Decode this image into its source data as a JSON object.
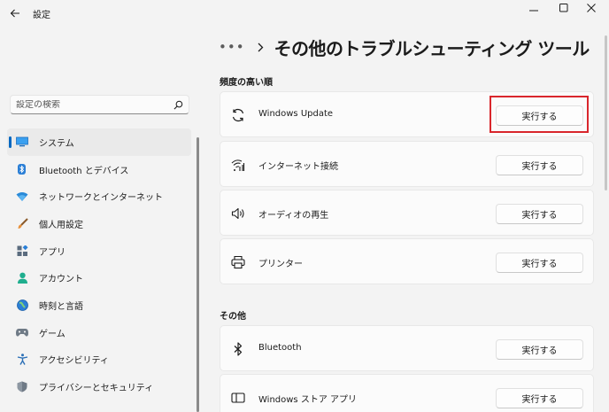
{
  "window": {
    "app_title": "設定",
    "back_icon": "back-arrow-icon",
    "minimize_icon": "minimize-icon",
    "maximize_icon": "maximize-icon",
    "close_icon": "close-icon"
  },
  "search": {
    "placeholder": "設定の検索",
    "icon": "search-icon"
  },
  "sidebar": {
    "items": [
      {
        "label": "システム",
        "icon": "system-display-icon",
        "selected": true
      },
      {
        "label": "Bluetooth とデバイス",
        "icon": "bluetooth-devices-icon",
        "selected": false
      },
      {
        "label": "ネットワークとインターネット",
        "icon": "network-wifi-icon",
        "selected": false
      },
      {
        "label": "個人用設定",
        "icon": "personalization-brush-icon",
        "selected": false
      },
      {
        "label": "アプリ",
        "icon": "apps-icon",
        "selected": false
      },
      {
        "label": "アカウント",
        "icon": "account-person-icon",
        "selected": false
      },
      {
        "label": "時刻と言語",
        "icon": "time-language-globe-icon",
        "selected": false
      },
      {
        "label": "ゲーム",
        "icon": "gaming-controller-icon",
        "selected": false
      },
      {
        "label": "アクセシビリティ",
        "icon": "accessibility-icon",
        "selected": false
      },
      {
        "label": "プライバシーとセキュリティ",
        "icon": "privacy-shield-icon",
        "selected": false
      }
    ]
  },
  "breadcrumb": {
    "more": "•••",
    "title": "その他のトラブルシューティング ツール"
  },
  "sections": {
    "frequent": {
      "label": "頻度の高い順",
      "items": [
        {
          "label": "Windows Update",
          "icon": "windows-update-sync-icon",
          "button": "実行する"
        },
        {
          "label": "インターネット接続",
          "icon": "internet-connection-icon",
          "button": "実行する"
        },
        {
          "label": "オーディオの再生",
          "icon": "audio-speaker-icon",
          "button": "実行する"
        },
        {
          "label": "プリンター",
          "icon": "printer-icon",
          "button": "実行する"
        }
      ]
    },
    "other": {
      "label": "その他",
      "items": [
        {
          "label": "Bluetooth",
          "icon": "bluetooth-icon",
          "button": "実行する"
        },
        {
          "label": "Windows ストア アプリ",
          "icon": "store-app-icon",
          "button": "実行する"
        }
      ]
    }
  },
  "colors": {
    "accent": "#0067c0",
    "highlight": "#d9262c",
    "background": "#f3f3f3",
    "card": "#fbfbfb"
  }
}
